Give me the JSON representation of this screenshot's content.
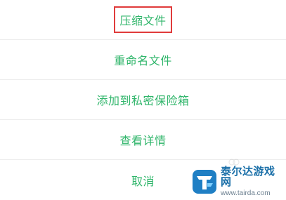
{
  "menu": {
    "items": [
      {
        "label": "压缩文件",
        "highlighted": true
      },
      {
        "label": "重命名文件",
        "highlighted": false
      },
      {
        "label": "添加到私密保险箱",
        "highlighted": false
      },
      {
        "label": "查看详情",
        "highlighted": false
      },
      {
        "label": "取消",
        "highlighted": false
      }
    ]
  },
  "watermark": {
    "title": "泰尔达游戏网",
    "url": "www.tairda.com",
    "icon": "tairda-logo-icon"
  },
  "colors": {
    "label": "#2fb56a",
    "highlight_border": "#e03b3b",
    "divider": "#ececec",
    "watermark_title": "#1a6fa8"
  }
}
